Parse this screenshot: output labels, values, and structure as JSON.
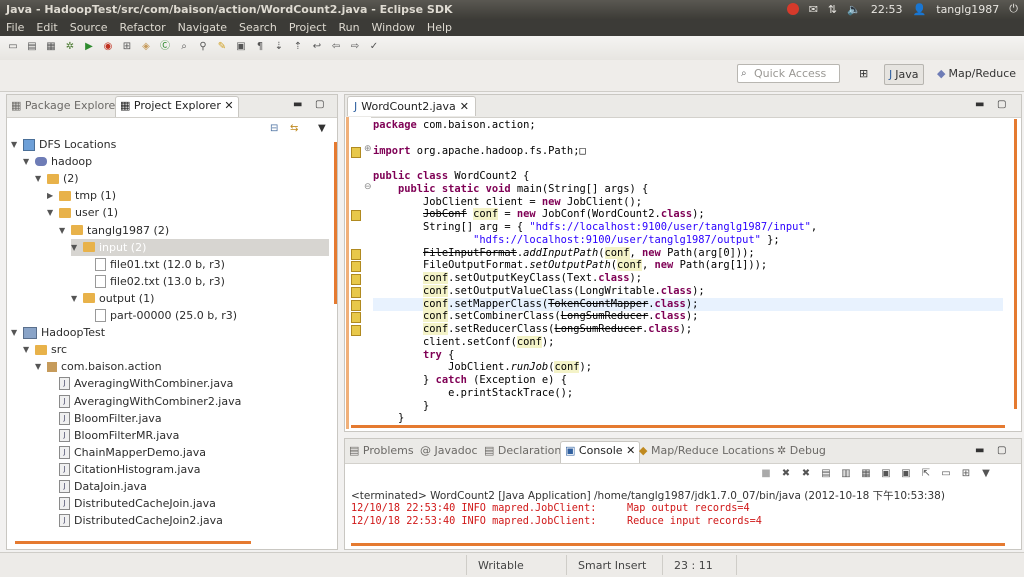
{
  "window": {
    "title": "Java - HadoopTest/src/com/baison/action/WordCount2.java - Eclipse SDK"
  },
  "system_tray": {
    "time": "22:53",
    "user": "tanglg1987"
  },
  "menu": [
    "File",
    "Edit",
    "Source",
    "Refactor",
    "Navigate",
    "Search",
    "Project",
    "Run",
    "Window",
    "Help"
  ],
  "quick_access": {
    "placeholder": "Quick Access"
  },
  "perspectives": {
    "java": "Java",
    "mapreduce": "Map/Reduce"
  },
  "left_panel": {
    "tabs": [
      "Package Explorer",
      "Project Explorer"
    ],
    "tree": [
      {
        "label": "DFS Locations",
        "level": 0,
        "kind": "dfs",
        "open": true
      },
      {
        "label": "hadoop",
        "level": 1,
        "kind": "elephant",
        "open": true
      },
      {
        "label": "(2)",
        "level": 2,
        "kind": "folder",
        "open": true
      },
      {
        "label": "tmp (1)",
        "level": 3,
        "kind": "folder",
        "open": false
      },
      {
        "label": "user (1)",
        "level": 3,
        "kind": "folder",
        "open": true
      },
      {
        "label": "tanglg1987 (2)",
        "level": 4,
        "kind": "folder",
        "open": true
      },
      {
        "label": "input (2)",
        "level": 5,
        "kind": "folder",
        "open": true,
        "selected": true
      },
      {
        "label": "file01.txt (12.0 b, r3)",
        "level": 6,
        "kind": "file"
      },
      {
        "label": "file02.txt (13.0 b, r3)",
        "level": 6,
        "kind": "file"
      },
      {
        "label": "output (1)",
        "level": 5,
        "kind": "folder",
        "open": true
      },
      {
        "label": "part-00000 (25.0 b, r3)",
        "level": 6,
        "kind": "file"
      },
      {
        "label": "HadoopTest",
        "level": 0,
        "kind": "project",
        "open": true
      },
      {
        "label": "src",
        "level": 1,
        "kind": "srcfolder",
        "open": true
      },
      {
        "label": "com.baison.action",
        "level": 2,
        "kind": "package",
        "open": true
      },
      {
        "label": "AveragingWithCombiner.java",
        "level": 3,
        "kind": "java"
      },
      {
        "label": "AveragingWithCombiner2.java",
        "level": 3,
        "kind": "java"
      },
      {
        "label": "BloomFilter.java",
        "level": 3,
        "kind": "java"
      },
      {
        "label": "BloomFilterMR.java",
        "level": 3,
        "kind": "java"
      },
      {
        "label": "ChainMapperDemo.java",
        "level": 3,
        "kind": "java"
      },
      {
        "label": "CitationHistogram.java",
        "level": 3,
        "kind": "java"
      },
      {
        "label": "DataJoin.java",
        "level": 3,
        "kind": "java"
      },
      {
        "label": "DistributedCacheJoin.java",
        "level": 3,
        "kind": "java"
      },
      {
        "label": "DistributedCacheJoin2.java",
        "level": 3,
        "kind": "java"
      }
    ]
  },
  "editor": {
    "tab": "WordCount2.java",
    "lines": [
      [
        {
          "t": "package ",
          "c": "kw"
        },
        {
          "t": "com.baison.action;"
        }
      ],
      [],
      [
        {
          "t": "import ",
          "c": "kw"
        },
        {
          "t": "org.apache.hadoop.fs.Path;"
        },
        {
          "t": "□"
        }
      ],
      [],
      [
        {
          "t": "public class ",
          "c": "kw"
        },
        {
          "t": "WordCount2 {"
        }
      ],
      [
        {
          "t": "    "
        },
        {
          "t": "public static void ",
          "c": "kw"
        },
        {
          "t": "main(String[] args) {"
        }
      ],
      [
        {
          "t": "        JobClient client = "
        },
        {
          "t": "new ",
          "c": "kw"
        },
        {
          "t": "JobClient();"
        }
      ],
      [
        {
          "t": "        "
        },
        {
          "t": "JobConf",
          "c": "strike"
        },
        {
          "t": " "
        },
        {
          "t": "conf",
          "c": "hl"
        },
        {
          "t": " = "
        },
        {
          "t": "new ",
          "c": "kw"
        },
        {
          "t": "JobConf(WordCount2."
        },
        {
          "t": "class",
          "c": "kw"
        },
        {
          "t": ");"
        }
      ],
      [
        {
          "t": "        String[] arg = { "
        },
        {
          "t": "\"hdfs://localhost:9100/user/tanglg1987/input\"",
          "c": "str"
        },
        {
          "t": ","
        }
      ],
      [
        {
          "t": "                \"hdfs://localhost:9100/user/tanglg1987/output\"",
          "c": "str"
        },
        {
          "t": " };"
        }
      ],
      [
        {
          "t": "        "
        },
        {
          "t": "FileInputFormat",
          "c": "strike"
        },
        {
          "t": "."
        },
        {
          "t": "addInputPath",
          "c": "ital"
        },
        {
          "t": "("
        },
        {
          "t": "conf",
          "c": "hl"
        },
        {
          "t": ", "
        },
        {
          "t": "new ",
          "c": "kw"
        },
        {
          "t": "Path(arg[0]));"
        }
      ],
      [
        {
          "t": "        FileOutputFormat."
        },
        {
          "t": "setOutputPath",
          "c": "ital"
        },
        {
          "t": "("
        },
        {
          "t": "conf",
          "c": "hl"
        },
        {
          "t": ", "
        },
        {
          "t": "new ",
          "c": "kw"
        },
        {
          "t": "Path(arg[1]));"
        }
      ],
      [
        {
          "t": "        "
        },
        {
          "t": "conf",
          "c": "hl"
        },
        {
          "t": ".setOutputKeyClass(Text."
        },
        {
          "t": "class",
          "c": "kw"
        },
        {
          "t": ");"
        }
      ],
      [
        {
          "t": "        "
        },
        {
          "t": "conf",
          "c": "hl"
        },
        {
          "t": ".setOutputValueClass(LongWritable."
        },
        {
          "t": "class",
          "c": "kw"
        },
        {
          "t": ");"
        }
      ],
      [
        {
          "t": "        "
        },
        {
          "t": "conf",
          "c": "hl"
        },
        {
          "t": ".setMapperClass("
        },
        {
          "t": "TokenCountMapper",
          "c": "strike"
        },
        {
          "t": "."
        },
        {
          "t": "class",
          "c": "kw"
        },
        {
          "t": ");"
        }
      ],
      [
        {
          "t": "        "
        },
        {
          "t": "conf",
          "c": "hl"
        },
        {
          "t": ".setCombinerClass("
        },
        {
          "t": "LongSumReducer",
          "c": "strike"
        },
        {
          "t": "."
        },
        {
          "t": "class",
          "c": "kw"
        },
        {
          "t": ");"
        }
      ],
      [
        {
          "t": "        "
        },
        {
          "t": "conf",
          "c": "hl"
        },
        {
          "t": ".setReducerClass("
        },
        {
          "t": "LongSumReducer",
          "c": "strike"
        },
        {
          "t": "."
        },
        {
          "t": "class",
          "c": "kw"
        },
        {
          "t": ");"
        }
      ],
      [
        {
          "t": "        client.setConf("
        },
        {
          "t": "conf",
          "c": "hl"
        },
        {
          "t": ");"
        }
      ],
      [
        {
          "t": "        "
        },
        {
          "t": "try ",
          "c": "kw"
        },
        {
          "t": "{"
        }
      ],
      [
        {
          "t": "            JobClient."
        },
        {
          "t": "runJob",
          "c": "ital"
        },
        {
          "t": "("
        },
        {
          "t": "conf",
          "c": "hl"
        },
        {
          "t": ");"
        }
      ],
      [
        {
          "t": "        } "
        },
        {
          "t": "catch ",
          "c": "kw"
        },
        {
          "t": "(Exception e) {"
        }
      ],
      [
        {
          "t": "            e.printStackTrace();"
        }
      ],
      [
        {
          "t": "        }"
        }
      ],
      [
        {
          "t": "    }"
        }
      ]
    ],
    "warning_lines": [
      2,
      7,
      10,
      11,
      12,
      13,
      14,
      15,
      16
    ],
    "current_line": 14,
    "fold_lines": [
      2,
      5
    ]
  },
  "console": {
    "tabs": [
      "Problems",
      "Javadoc",
      "Declaration",
      "Console",
      "Map/Reduce Locations",
      "Debug"
    ],
    "terminated": "<terminated> WordCount2 [Java Application] /home/tanglg1987/jdk1.7.0_07/bin/java (2012-10-18 下午10:53:38)",
    "output": [
      "12/10/18 22:53:40 INFO mapred.JobClient:     Map output records=4",
      "12/10/18 22:53:40 INFO mapred.JobClient:     Reduce input records=4"
    ]
  },
  "status": {
    "writable": "Writable",
    "insert": "Smart Insert",
    "position": "23 : 11"
  },
  "colors": {
    "accent": "#e57a30",
    "keyword": "#7f0055",
    "string": "#2a00ff",
    "console_out": "#d01818"
  }
}
